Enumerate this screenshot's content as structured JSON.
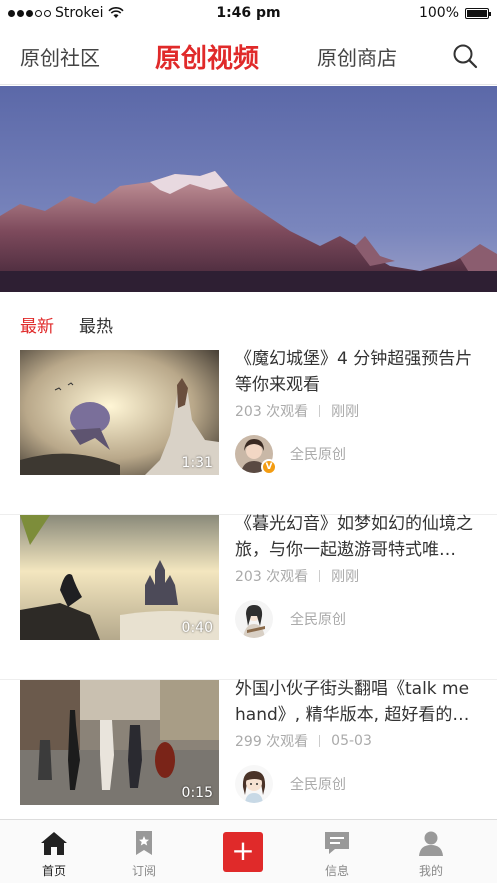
{
  "status_bar": {
    "carrier": "Strokei",
    "time": "1:46 pm",
    "battery": "100%"
  },
  "top_nav": {
    "left_tab": "原创社区",
    "center_tab": "原创视频",
    "right_tab": "原创商店"
  },
  "filters": {
    "latest": "最新",
    "hottest": "最热"
  },
  "videos": [
    {
      "title": "《魔幻城堡》4 分钟超强预告片等你来观看",
      "views": "203 次观看",
      "time": "刚刚",
      "author": "全民原创",
      "duration": "1:31"
    },
    {
      "title": "《暮光幻音》如梦如幻的仙境之旅，与你一起遨游哥特式唯…",
      "views": "203 次观看",
      "time": "刚刚",
      "author": "全民原创",
      "duration": "0:40"
    },
    {
      "title": "外国小伙子街头翻唱《talk me hand》, 精华版本, 超好看的…",
      "views": "299 次观看",
      "time": "05-03",
      "author": "全民原创",
      "duration": "0:15"
    }
  ],
  "bottom_tabs": {
    "home": "首页",
    "subscribe": "订阅",
    "plus": "+",
    "messages": "信息",
    "mine": "我的"
  },
  "colors": {
    "accent": "#e02a2a",
    "muted": "#aaaaaa"
  }
}
